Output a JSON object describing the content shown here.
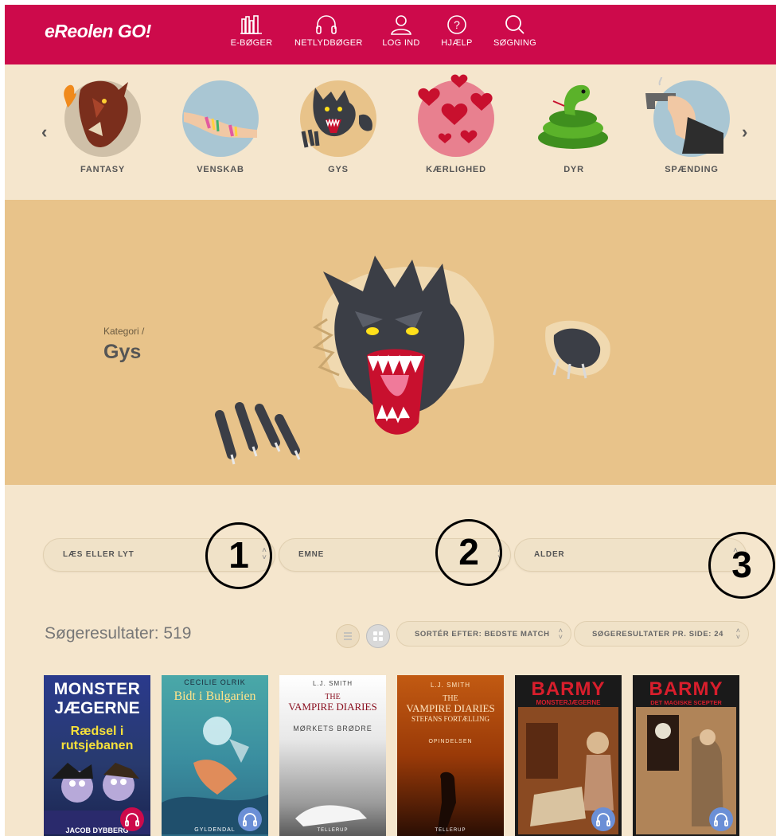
{
  "header": {
    "logo": "eReolen GO!",
    "nav": [
      {
        "label": "E-BØGER",
        "icon": "books-icon"
      },
      {
        "label": "NETLYDBØGER",
        "icon": "headphones-icon"
      },
      {
        "label": "LOG IND",
        "icon": "user-icon"
      },
      {
        "label": "HJÆLP",
        "icon": "help-icon"
      },
      {
        "label": "SØGNING",
        "icon": "search-icon"
      }
    ]
  },
  "categories": [
    {
      "label": "FANTASY"
    },
    {
      "label": "VENSKAB"
    },
    {
      "label": "GYS"
    },
    {
      "label": "KÆRLIGHED"
    },
    {
      "label": "DYR"
    },
    {
      "label": "SPÆNDING"
    }
  ],
  "hero": {
    "breadcrumb": "Kategori /",
    "title": "Gys"
  },
  "filters": [
    {
      "label": "LÆS ELLER LYT"
    },
    {
      "label": "EMNE"
    },
    {
      "label": "ALDER"
    }
  ],
  "annotations": [
    "1",
    "2",
    "3"
  ],
  "results": {
    "count_label": "Søgeresultater: 519",
    "sort_label": "SORTÉR EFTER: BEDSTE MATCH",
    "per_page_label": "SØGERESULTATER PR. SIDE: 24"
  },
  "books": [
    {
      "author": "",
      "title_top": "MONSTER",
      "title_mid": "JÆGERNE",
      "subtitle": "Rædsel i rutsjebanen",
      "publisher": "JACOB DYBBERG",
      "badge_color": "#cd0a4b"
    },
    {
      "author": "CECILIE OLRIK",
      "title_top": "Bidt i Bulgarien",
      "publisher": "GYLDENDAL",
      "badge_color": "#6b8fd6"
    },
    {
      "author": "L.J. SMITH",
      "title_top": "THE",
      "title_mid": "VAMPIRE DIARIES",
      "subtitle": "MØRKETS BRØDRE",
      "publisher": "TELLERUP"
    },
    {
      "author": "L.J. SMITH",
      "title_top": "THE",
      "title_mid": "VAMPIRE DIARIES",
      "subtitle": "STEFANS FORTÆLLING",
      "sub2": "OPINDELSEN",
      "publisher": "TELLERUP"
    },
    {
      "title_top": "BARMY",
      "subtitle": "MONSTERJÆGERNE",
      "badge_color": "#6b8fd6"
    },
    {
      "title_top": "BARMY",
      "subtitle": "DET MAGISKE SCEPTER",
      "badge_color": "#6b8fd6"
    }
  ]
}
